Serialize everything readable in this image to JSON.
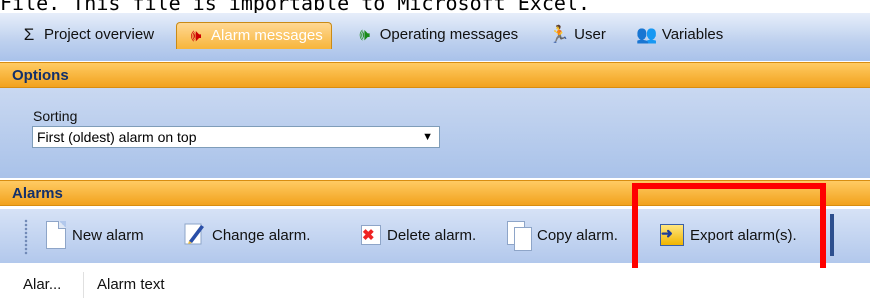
{
  "caption_line": "File. This file is importable to Microsoft Excel.",
  "tabs": [
    {
      "label": "Project overview",
      "icon": "sigma-icon",
      "glyph": "Σ"
    },
    {
      "label": "Alarm messages",
      "icon": "alarm-speaker-icon",
      "glyph": "🕪"
    },
    {
      "label": "Operating messages",
      "icon": "operating-speaker-icon",
      "glyph": "🕪"
    },
    {
      "label": "User",
      "icon": "user-icon",
      "glyph": "🏃"
    },
    {
      "label": "Variables",
      "icon": "variables-icon",
      "glyph": "👥"
    }
  ],
  "options": {
    "header": "Options",
    "sorting_label": "Sorting",
    "sorting_value": "First (oldest) alarm on top"
  },
  "alarms": {
    "header": "Alarms",
    "toolbar": {
      "new": "New alarm",
      "change": "Change alarm.",
      "delete": "Delete alarm.",
      "copy": "Copy alarm.",
      "export": "Export alarm(s)."
    },
    "columns": [
      "Alar...",
      "Alarm text"
    ]
  },
  "colors": {
    "highlight": "#ff0000",
    "accent": "#f2a21d",
    "toolbar": "#b2c8ec"
  }
}
